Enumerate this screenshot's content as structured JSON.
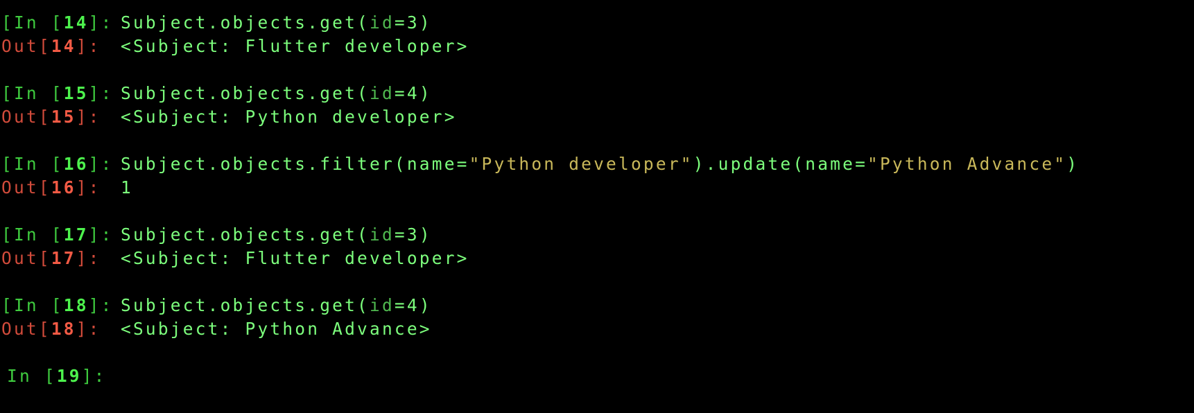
{
  "colors": {
    "background": "#000000",
    "in_prompt": "#3fcc3f",
    "out_prompt": "#d24b3b",
    "code": "#7dff7d",
    "string": "#c9b85a",
    "keyword_arg": "#4fb84f"
  },
  "cells": [
    {
      "in_label_open": "[In [",
      "in_number": "14",
      "in_label_close": "]: ",
      "code": {
        "pre": "Subject.objects.get(",
        "kw": "id",
        "post": "=3)"
      },
      "out_label_open": "Out[",
      "out_number": "14",
      "out_label_close": "]: ",
      "output": "<Subject: Flutter developer>"
    },
    {
      "in_label_open": "[In [",
      "in_number": "15",
      "in_label_close": "]: ",
      "code": {
        "pre": "Subject.objects.get(",
        "kw": "id",
        "post": "=4)"
      },
      "out_label_open": "Out[",
      "out_number": "15",
      "out_label_close": "]: ",
      "output": "<Subject: Python developer>"
    },
    {
      "in_label_open": "[In [",
      "in_number": "16",
      "in_label_close": "]: ",
      "code": {
        "part1": "Subject.objects.filter(name=",
        "str1": "\"Python developer\"",
        "part2": ").update(name=",
        "str2": "\"Python Advance\"",
        "part3": ")"
      },
      "out_label_open": "Out[",
      "out_number": "16",
      "out_label_close": "]: ",
      "output": "1"
    },
    {
      "in_label_open": "[In [",
      "in_number": "17",
      "in_label_close": "]: ",
      "code": {
        "pre": "Subject.objects.get(",
        "kw": "id",
        "post": "=3)"
      },
      "out_label_open": "Out[",
      "out_number": "17",
      "out_label_close": "]: ",
      "output": "<Subject: Flutter developer>"
    },
    {
      "in_label_open": "[In [",
      "in_number": "18",
      "in_label_close": "]: ",
      "code": {
        "pre": "Subject.objects.get(",
        "kw": "id",
        "post": "=4)"
      },
      "out_label_open": "Out[",
      "out_number": "18",
      "out_label_close": "]: ",
      "output": "<Subject: Python Advance>"
    }
  ],
  "current_prompt": {
    "in_label_open": "In [",
    "in_number": "19",
    "in_label_close": "]: "
  }
}
